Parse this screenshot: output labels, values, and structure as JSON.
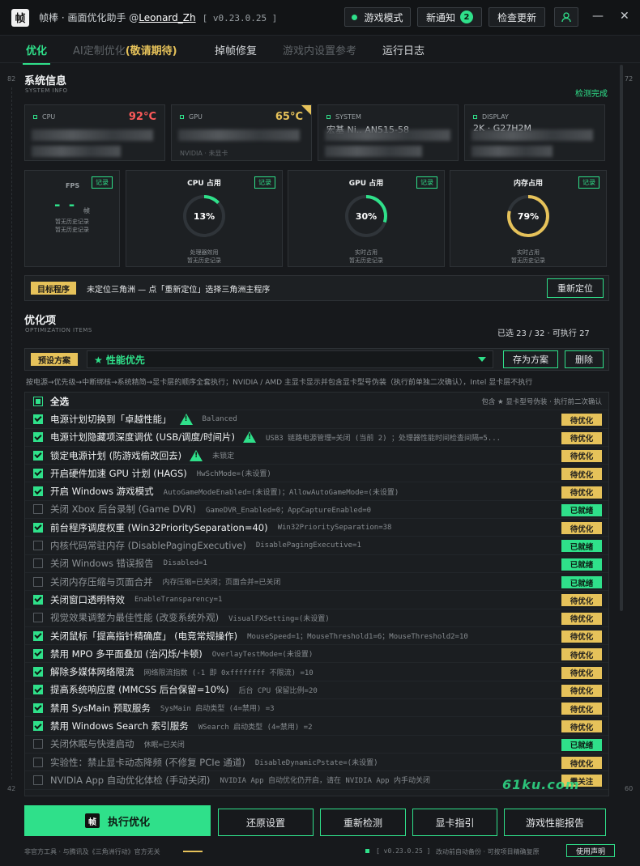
{
  "titlebar": {
    "logo": "帧",
    "title_prefix": "帧棒 · 画面优化助手 @",
    "user": "Leonard_Zh",
    "version": "[ v0.23.0.25 ]",
    "game_mode": "游戏模式",
    "notify": "新通知",
    "notify_count": "2",
    "check_update": "检查更新",
    "minimize": "—",
    "close": "✕"
  },
  "tabs": [
    {
      "label": "优化"
    },
    {
      "label": "AI定制优化",
      "highlight": "(敬请期待)"
    },
    {
      "label": "掉帧修复"
    },
    {
      "label": "游戏内设置参考"
    },
    {
      "label": "运行日志"
    }
  ],
  "scroll": {
    "left_top": "82",
    "right_top": "72",
    "left_bottom": "42",
    "right_bottom": "60"
  },
  "sysinfo": {
    "title": "系统信息",
    "subtitle": "SYSTEM INFO",
    "status": "检测完成",
    "cards": [
      {
        "label": "CPU",
        "temp": "92°C",
        "temp_color": "#ff5a5a"
      },
      {
        "label": "GPU",
        "temp": "65°C",
        "temp_color": "#e6c25a",
        "detail": "NVIDIA · 未显卡"
      },
      {
        "label": "SYSTEM",
        "value": "宏基 Ni.. AN515-58"
      },
      {
        "label": "DISPLAY",
        "value": "2K · G27H2M"
      }
    ]
  },
  "metrics": {
    "record": "记录",
    "fps": {
      "label": "FPS",
      "value": "- -",
      "unit": "帧",
      "line1": "暂无历史记录",
      "line2": "暂无历史记录"
    },
    "cpu": {
      "title": "CPU 占用",
      "value": "13%",
      "percent": 13,
      "line1": "处理器效用",
      "line2": "暂无历史记录"
    },
    "gpu": {
      "title": "GPU 占用",
      "value": "30%",
      "percent": 30,
      "line1": "实时占用",
      "line2": "暂无历史记录"
    },
    "mem": {
      "title": "内存占用",
      "value": "79%",
      "percent": 79,
      "line1": "实时占用",
      "line2": "暂无历史记录"
    }
  },
  "target": {
    "label": "目标程序",
    "text": "未定位三角洲 — 点「重新定位」选择三角洲主程序",
    "button": "重新定位"
  },
  "optimize": {
    "title": "优化项",
    "subtitle": "OPTIMIZATION ITEMS",
    "summary": "已选 23 / 32 · 可执行 27",
    "preset_label": "预设方案",
    "preset_value": "★ 性能优先",
    "save_preset": "存为方案",
    "delete": "删除",
    "description": "按电源→优先级→中断绑核→系统精简→显卡层的顺序全套执行；NVIDIA / AMD 主显卡显示并包含显卡型号伪装（执行前单独二次确认），Intel 显卡层不执行",
    "select_all": "全选",
    "select_all_note": "包含 ★ 显卡型号伪装 · 执行前二次确认",
    "items": [
      {
        "name": "电源计划切换到「卓越性能」",
        "warn": true,
        "detail": "Balanced",
        "checked": true,
        "status": "待优化",
        "kind": "todo"
      },
      {
        "name": "电源计划隐藏项深度调优 (USB/调度/时间片)",
        "warn": true,
        "detail": "USB3 链路电源管理=关闭 (当前 2) ；处理器性能时间检查间隔=5...",
        "checked": true,
        "status": "待优化",
        "kind": "todo"
      },
      {
        "name": "锁定电源计划 (防游戏偷改回去)",
        "warn": true,
        "detail": "未锁定",
        "checked": true,
        "status": "待优化",
        "kind": "todo"
      },
      {
        "name": "开启硬件加速 GPU 计划 (HAGS)",
        "warn": false,
        "detail": "HwSchMode=(未设置)",
        "checked": true,
        "status": "待优化",
        "kind": "todo"
      },
      {
        "name": "开启 Windows 游戏模式",
        "warn": false,
        "detail": "AutoGameModeEnabled=(未设置)；AllowAutoGameMode=(未设置)",
        "checked": true,
        "status": "待优化",
        "kind": "todo"
      },
      {
        "name": "关闭 Xbox 后台录制 (Game DVR)",
        "warn": false,
        "detail": "GameDVR_Enabled=0；AppCaptureEnabled=0",
        "checked": false,
        "status": "已就绪",
        "kind": "done"
      },
      {
        "name": "前台程序调度权重 (Win32PrioritySeparation=40)",
        "warn": false,
        "detail": "Win32PrioritySeparation=38",
        "checked": true,
        "status": "待优化",
        "kind": "todo"
      },
      {
        "name": "内核代码常驻内存 (DisablePagingExecutive)",
        "warn": false,
        "detail": "DisablePagingExecutive=1",
        "checked": false,
        "status": "已就绪",
        "kind": "done"
      },
      {
        "name": "关闭 Windows 错误报告",
        "warn": false,
        "detail": "Disabled=1",
        "checked": false,
        "status": "已就绪",
        "kind": "done"
      },
      {
        "name": "关闭内存压缩与页面合并",
        "warn": false,
        "detail": "内存压缩=已关闭；页面合并=已关闭",
        "checked": false,
        "status": "已就绪",
        "kind": "done"
      },
      {
        "name": "关闭窗口透明特效",
        "warn": false,
        "detail": "EnableTransparency=1",
        "checked": true,
        "status": "待优化",
        "kind": "todo"
      },
      {
        "name": "视觉效果调整为最佳性能 (改变系统外观)",
        "warn": false,
        "detail": "VisualFXSetting=(未设置)",
        "checked": false,
        "status": "待优化",
        "kind": "todo"
      },
      {
        "name": "关闭鼠标「提高指针精确度」 (电竞常规操作)",
        "warn": false,
        "detail": "MouseSpeed=1；MouseThreshold1=6；MouseThreshold2=10",
        "checked": true,
        "status": "待优化",
        "kind": "todo"
      },
      {
        "name": "禁用 MPO 多平面叠加 (治闪烁/卡顿)",
        "warn": false,
        "detail": "OverlayTestMode=(未设置)",
        "checked": true,
        "status": "待优化",
        "kind": "todo"
      },
      {
        "name": "解除多媒体网络限流",
        "warn": false,
        "detail": "网络限流指数 (-1 即 0xffffffff 不限流) =10",
        "checked": true,
        "status": "待优化",
        "kind": "todo"
      },
      {
        "name": "提高系统响应度 (MMCSS 后台保留=10%)",
        "warn": false,
        "detail": "后台 CPU 保留比例=20",
        "checked": true,
        "status": "待优化",
        "kind": "todo"
      },
      {
        "name": "禁用 SysMain 预取服务",
        "warn": false,
        "detail": "SysMain 启动类型 (4=禁用) =3",
        "checked": true,
        "status": "待优化",
        "kind": "todo"
      },
      {
        "name": "禁用 Windows Search 索引服务",
        "warn": false,
        "detail": "WSearch 启动类型 (4=禁用) =2",
        "checked": true,
        "status": "待优化",
        "kind": "todo"
      },
      {
        "name": "关闭休眠与快速启动",
        "warn": false,
        "detail": "休眠=已关闭",
        "checked": false,
        "status": "已就绪",
        "kind": "done"
      },
      {
        "name": "实验性：禁止显卡动态降频 (不修复 PCIe 通道)",
        "warn": false,
        "detail": "DisableDynamicPstate=(未设置)",
        "checked": false,
        "status": "待优化",
        "kind": "todo"
      },
      {
        "name": "NVIDIA App 自动优化体检 (手动关闭)",
        "warn": false,
        "detail": "NVIDIA App 自动优化仍开启，请在 NVIDIA App 内手动关闭",
        "checked": false,
        "status": "需关注",
        "kind": "focus"
      }
    ]
  },
  "actions": {
    "execute": "执行优化",
    "exec_icon": "帧",
    "restore": "还原设置",
    "redetect": "重新检测",
    "gpu_guide": "显卡指引",
    "report": "游戏性能报告"
  },
  "footer": {
    "left": "非官方工具 · 与腾讯及《三角洲行动》官方无关",
    "version": "[ v0.23.0.25 ]",
    "right": "改动前自动备份 · 可按项目精确复原",
    "button": "使用声明"
  },
  "watermark": "61ku.com",
  "colors": {
    "accent": "#2fe08a",
    "warn": "#e6c25a",
    "hot": "#ff5a5a",
    "bg": "#17191c"
  }
}
